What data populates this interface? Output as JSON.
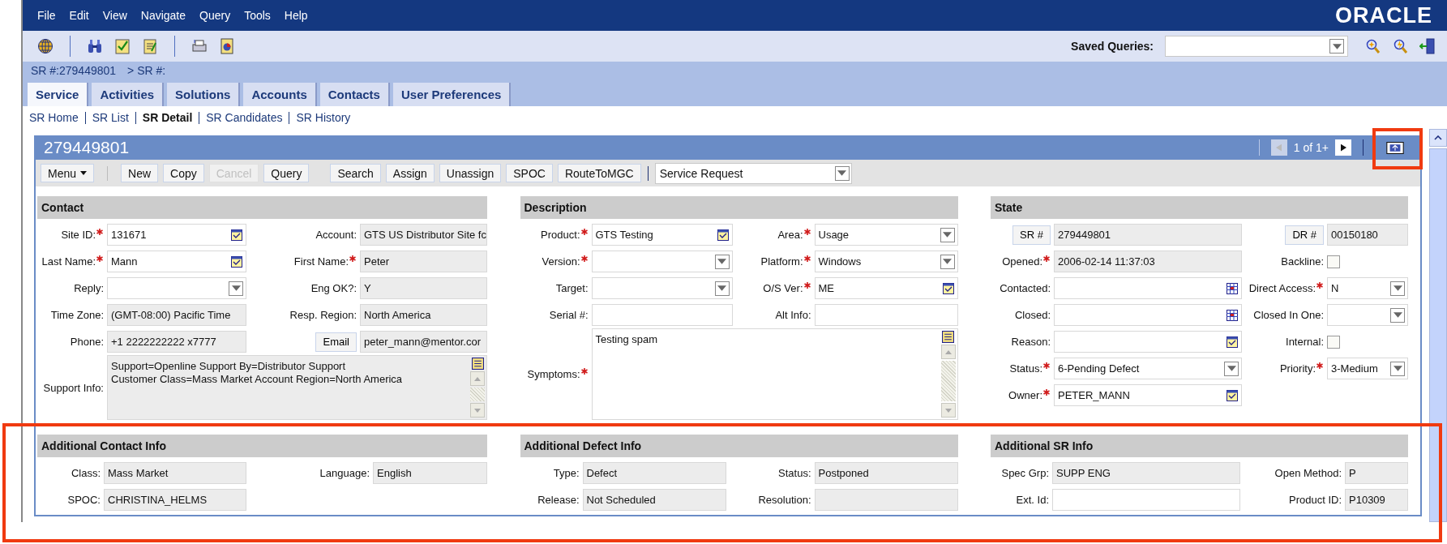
{
  "menu": [
    "File",
    "Edit",
    "View",
    "Navigate",
    "Query",
    "Tools",
    "Help"
  ],
  "logo": "ORACLE",
  "saved_queries": {
    "label": "Saved Queries:"
  },
  "breadcrumb": [
    "SR #:279449801",
    "> SR #:"
  ],
  "tabs": [
    {
      "label": "Service",
      "selected": true
    },
    {
      "label": "Activities",
      "selected": false
    },
    {
      "label": "Solutions",
      "selected": false
    },
    {
      "label": "Accounts",
      "selected": false
    },
    {
      "label": "Contacts",
      "selected": false
    },
    {
      "label": "User Preferences",
      "selected": false
    }
  ],
  "subnav": [
    {
      "label": "SR Home",
      "selected": false
    },
    {
      "label": "SR List",
      "selected": false
    },
    {
      "label": "SR Detail",
      "selected": true
    },
    {
      "label": "SR Candidates",
      "selected": false
    },
    {
      "label": "SR History",
      "selected": false
    }
  ],
  "record": {
    "title": "279449801",
    "pager": "1 of 1+"
  },
  "actions": [
    {
      "label": "Menu",
      "kind": "menu",
      "disabled": false
    },
    {
      "label": "New",
      "kind": "button",
      "disabled": false
    },
    {
      "label": "Copy",
      "kind": "button",
      "disabled": false
    },
    {
      "label": "Cancel",
      "kind": "button",
      "disabled": true
    },
    {
      "label": "Query",
      "kind": "button",
      "disabled": false
    },
    {
      "label": "Search",
      "kind": "button",
      "disabled": false
    },
    {
      "label": "Assign",
      "kind": "button",
      "disabled": false
    },
    {
      "label": "Unassign",
      "kind": "button",
      "disabled": false
    },
    {
      "label": "SPOC",
      "kind": "button",
      "disabled": false
    },
    {
      "label": "RouteToMGC",
      "kind": "button",
      "disabled": false
    }
  ],
  "record_type": "Service Request",
  "sections": [
    {
      "title": "Contact",
      "rows": [
        [
          {
            "label": "Site ID:",
            "required": true,
            "kind": "lookup",
            "value": "131671"
          },
          {
            "label": "Account:",
            "required": false,
            "kind": "readonly",
            "value": "GTS US Distributor Site fc"
          }
        ],
        [
          {
            "label": "Last Name:",
            "required": true,
            "kind": "lookup",
            "value": "Mann"
          },
          {
            "label": "First Name:",
            "required": true,
            "kind": "readonly",
            "value": "Peter"
          }
        ],
        [
          {
            "label": "Reply:",
            "required": false,
            "kind": "select"
          },
          {
            "label": "Eng OK?:",
            "required": false,
            "kind": "readonly",
            "value": "Y"
          }
        ],
        [
          {
            "label": "Time Zone:",
            "required": false,
            "kind": "readonly",
            "value": "(GMT-08:00) Pacific Time"
          },
          {
            "label": "Resp. Region:",
            "required": false,
            "kind": "readonly",
            "value": "North America"
          }
        ],
        [
          {
            "label": "Phone:",
            "required": false,
            "kind": "readonly",
            "value": "+1 2222222222 x7777"
          },
          {
            "label": "Email",
            "label_is_button": true,
            "required": false,
            "kind": "readonly",
            "value": "peter_mann@mentor.cor"
          }
        ],
        [
          {
            "label": "Support Info:",
            "required": false,
            "kind": "memo_readonly",
            "lines": [
              "Support=Openline    Support By=Distributor Support",
              "Customer Class=Mass Market  Account Region=North America"
            ]
          }
        ]
      ]
    },
    {
      "title": "Description",
      "rows": [
        [
          {
            "label": "Product:",
            "required": true,
            "kind": "lookup",
            "value": "GTS Testing"
          },
          {
            "label": "Area:",
            "required": true,
            "kind": "select",
            "value": "Usage"
          }
        ],
        [
          {
            "label": "Version:",
            "required": true,
            "kind": "select"
          },
          {
            "label": "Platform:",
            "required": true,
            "kind": "select",
            "value": "Windows"
          }
        ],
        [
          {
            "label": "Target:",
            "required": false,
            "kind": "select"
          },
          {
            "label": "O/S Ver:",
            "required": true,
            "kind": "lookup",
            "value": "ME"
          }
        ],
        [
          {
            "label": "Serial #:",
            "required": false,
            "kind": "text"
          },
          {
            "label": "Alt Info:",
            "required": false,
            "kind": "text"
          }
        ],
        [
          {
            "label": "Symptoms:",
            "required": true,
            "kind": "memo",
            "lines": [
              "Testing spam"
            ]
          }
        ]
      ]
    },
    {
      "title": "State",
      "rows": [
        [
          {
            "label": "SR #",
            "label_is_button": true,
            "required": false,
            "kind": "readonly",
            "value": "279449801"
          },
          {
            "label": "DR #",
            "label_is_button": true,
            "required": false,
            "kind": "readonly",
            "value": "00150180"
          }
        ],
        [
          {
            "label": "Opened:",
            "required": true,
            "kind": "readonly",
            "value": "2006-02-14 11:37:03"
          },
          {
            "label": "Backline:",
            "required": false,
            "kind": "checkbox",
            "checked": false
          }
        ],
        [
          {
            "label": "Contacted:",
            "required": false,
            "kind": "date"
          },
          {
            "label": "Direct Access:",
            "required": true,
            "kind": "select",
            "value": "N"
          }
        ],
        [
          {
            "label": "Closed:",
            "required": false,
            "kind": "date"
          },
          {
            "label": "Closed In One:",
            "required": false,
            "kind": "select"
          }
        ],
        [
          {
            "label": "Reason:",
            "required": false,
            "kind": "lookup"
          },
          {
            "label": "Internal:",
            "required": false,
            "kind": "checkbox",
            "checked": false
          }
        ],
        [
          {
            "label": "Status:",
            "required": true,
            "kind": "select",
            "value": "6-Pending Defect"
          },
          {
            "label": "Priority:",
            "required": true,
            "kind": "select",
            "value": "3-Medium"
          }
        ],
        [
          {
            "label": "Owner:",
            "required": true,
            "kind": "lookup",
            "value": "PETER_MANN"
          }
        ]
      ]
    }
  ],
  "additional": [
    {
      "title": "Additional Contact Info",
      "rows": [
        [
          {
            "label": "Class:",
            "kind": "readonly",
            "value": "Mass Market"
          },
          {
            "label": "Language:",
            "kind": "readonly",
            "value": "English"
          }
        ],
        [
          {
            "label": "SPOC:",
            "kind": "readonly",
            "value": "CHRISTINA_HELMS"
          }
        ]
      ]
    },
    {
      "title": "Additional Defect Info",
      "rows": [
        [
          {
            "label": "Type:",
            "kind": "readonly",
            "value": "Defect"
          },
          {
            "label": "Status:",
            "kind": "readonly",
            "value": "Postponed"
          }
        ],
        [
          {
            "label": "Release:",
            "kind": "readonly",
            "value": "Not Scheduled"
          },
          {
            "label": "Resolution:",
            "kind": "readonly"
          }
        ]
      ]
    },
    {
      "title": "Additional SR Info",
      "rows": [
        [
          {
            "label": "Spec Grp:",
            "kind": "readonly",
            "value": "SUPP ENG"
          },
          {
            "label": "Open Method:",
            "kind": "readonly",
            "value": "P"
          }
        ],
        [
          {
            "label": "Ext. Id:",
            "kind": "text"
          },
          {
            "label": "Product ID:",
            "kind": "readonly",
            "value": "P10309"
          }
        ]
      ]
    }
  ]
}
